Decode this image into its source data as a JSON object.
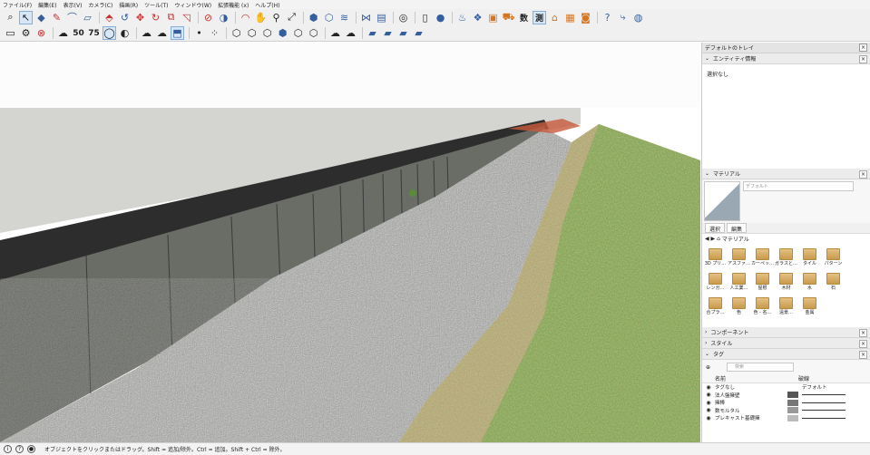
{
  "menu": [
    "ファイル(F)",
    "編集(E)",
    "表示(V)",
    "カメラ(C)",
    "描画(R)",
    "ツール(T)",
    "ウィンドウ(W)",
    "拡張機能 (x)",
    "ヘルプ(H)"
  ],
  "toolbar": {
    "text_tool_label": "数",
    "measure_tool_label": "測",
    "stamp_50": "50",
    "stamp_75": "75"
  },
  "tray": {
    "title": "デフォルトのトレイ",
    "entity_info": {
      "title": "エンティティ情報",
      "selection": "選択なし"
    },
    "materials": {
      "title": "マテリアル",
      "name_placeholder": "デフォルト",
      "tab_select": "選択",
      "tab_edit": "編集",
      "collection": "マテリアル",
      "items": [
        "3D プリ…",
        "アスファ…",
        "カーペッ…",
        "ガラスと…",
        "タイル",
        "パターン",
        "レンガ…",
        "人工業…",
        "屋根",
        "木材",
        "水",
        "石",
        "合プラ…",
        "色",
        "色 - 名…",
        "遠景…",
        "金属"
      ]
    },
    "components": {
      "title": "コンポーネント"
    },
    "styles": {
      "title": "スタイル"
    },
    "tags": {
      "title": "タグ",
      "search_placeholder": "検索",
      "col_name": "名前",
      "col_dash": "破線",
      "rows": [
        {
          "name": "タグなし",
          "dash": "デフォルト"
        },
        {
          "name": "法人盤擁壁",
          "dash": ""
        },
        {
          "name": "擁棒",
          "dash": ""
        },
        {
          "name": "数モルタル",
          "dash": ""
        },
        {
          "name": "プレキャスト基礎擁",
          "dash": ""
        }
      ]
    }
  },
  "status": {
    "message": "オブジェクトをクリックまたはドラッグ。Shift = 追加/除外。Ctrl = 追加。Shift + Ctrl = 除外。"
  },
  "colors": {
    "accent": "#355f9c",
    "wall": "#6a6c66",
    "grass": "#7a9a4a"
  }
}
